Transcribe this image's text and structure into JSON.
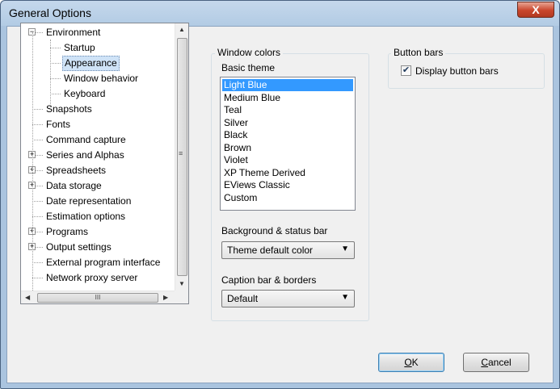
{
  "window": {
    "title": "General Options",
    "close_glyph": "X"
  },
  "tree": {
    "items": [
      {
        "label": "Environment",
        "expander": "−",
        "level": 0
      },
      {
        "label": "Startup",
        "level": 1
      },
      {
        "label": "Appearance",
        "level": 1,
        "selected": true
      },
      {
        "label": "Window behavior",
        "level": 1
      },
      {
        "label": "Keyboard",
        "level": 1
      },
      {
        "label": "Snapshots",
        "level": 0
      },
      {
        "label": "Fonts",
        "level": 0
      },
      {
        "label": "Command capture",
        "level": 0
      },
      {
        "label": "Series and Alphas",
        "expander": "+",
        "level": 0
      },
      {
        "label": "Spreadsheets",
        "expander": "+",
        "level": 0
      },
      {
        "label": "Data storage",
        "expander": "+",
        "level": 0
      },
      {
        "label": "Date representation",
        "level": 0
      },
      {
        "label": "Estimation options",
        "level": 0
      },
      {
        "label": "Programs",
        "expander": "+",
        "level": 0
      },
      {
        "label": "Output settings",
        "expander": "+",
        "level": 0
      },
      {
        "label": "External program interface",
        "level": 0
      },
      {
        "label": "Network proxy server",
        "level": 0
      }
    ],
    "scroll_thumb_grip": "≡",
    "hscroll_grip": "III"
  },
  "window_colors": {
    "group_title": "Window colors",
    "basic_theme_label": "Basic theme",
    "themes": [
      "Light Blue",
      "Medium Blue",
      "Teal",
      "Silver",
      "Black",
      "Brown",
      "Violet",
      "XP Theme Derived",
      "EViews Classic",
      "Custom"
    ],
    "selected_theme": "Light Blue",
    "background_label": "Background & status bar",
    "background_value": "Theme default color",
    "caption_label": "Caption bar & borders",
    "caption_value": "Default"
  },
  "button_bars": {
    "group_title": "Button bars",
    "checkbox_label": "Display button bars",
    "checked": true
  },
  "buttons": {
    "ok": "OK",
    "cancel": "Cancel"
  },
  "colors": {
    "selection": "#3399ff",
    "title_bar": "#b9cfe6",
    "close_button": "#c9462c"
  }
}
